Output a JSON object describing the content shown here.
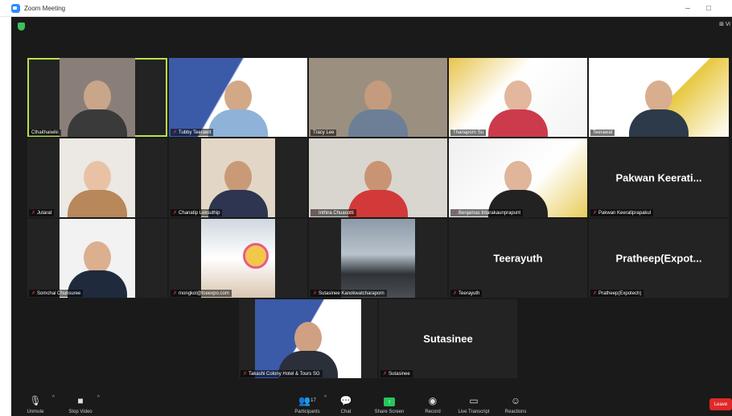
{
  "window": {
    "title": "Zoom Meeting",
    "minimize": "–",
    "maximize": "□",
    "close": "×"
  },
  "meeting": {
    "view_label": "⊞ Vi"
  },
  "participants": [
    {
      "name": "Cthaithaiwiki",
      "big_name": ""
    },
    {
      "name": "Tubby Teerawit",
      "big_name": ""
    },
    {
      "name": "Tracy Lee",
      "big_name": ""
    },
    {
      "name": "Thanaporn Su",
      "big_name": ""
    },
    {
      "name": "Teerawat",
      "big_name": ""
    },
    {
      "name": "Jutarat",
      "big_name": ""
    },
    {
      "name": "Chanatip Leksuthip",
      "big_name": ""
    },
    {
      "name": "Inthira Chuasotti",
      "big_name": ""
    },
    {
      "name": "Benjamas Intarakaunprapunt",
      "big_name": ""
    },
    {
      "name": "Pakwan Keeratiprapakul",
      "big_name": "Pakwan  Keerati..."
    },
    {
      "name": "Somchai Chunsuree",
      "big_name": ""
    },
    {
      "name": "mongkol@tceexpo.com",
      "big_name": ""
    },
    {
      "name": "Sutasinee Kanokwatcharaporn",
      "big_name": ""
    },
    {
      "name": "Teerayuth",
      "big_name": "Teerayuth"
    },
    {
      "name": "Pratheep(Expotech)",
      "big_name": "Pratheep(Expot..."
    },
    {
      "name": "Takashi Colony Hotel & Tours SG",
      "big_name": ""
    },
    {
      "name": "Sutasinee",
      "big_name": "Sutasinee"
    }
  ],
  "toolbar": {
    "unmute": "Unmute",
    "stop_video": "Stop Video",
    "participants": "Participants",
    "participants_count": "17",
    "chat": "Chat",
    "share_screen": "Share Screen",
    "record": "Record",
    "live_transcript": "Live Transcript",
    "reactions": "Reactions",
    "leave": "Leave"
  },
  "colors": {
    "active_speaker": "#b8e24a",
    "share_screen": "#23c75a",
    "leave": "#e02828",
    "shield": "#3cc159",
    "muted_mic": "#e0302f"
  }
}
